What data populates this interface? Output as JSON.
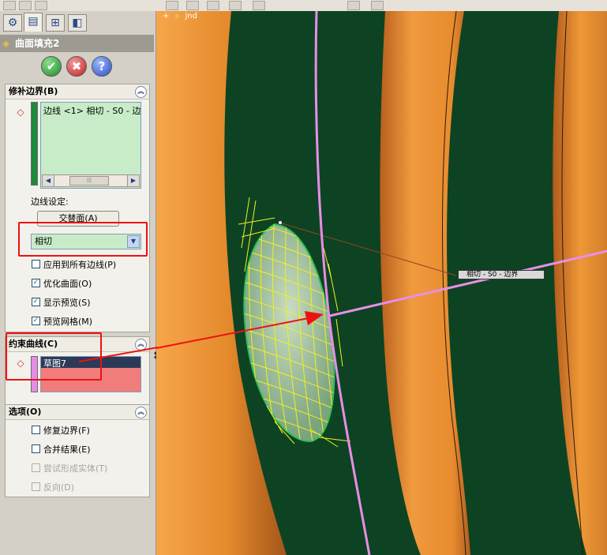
{
  "panel": {
    "feature_title": "曲面填充2",
    "tabs": [
      "feature-manager-icon",
      "property-manager-icon",
      "configuration-manager-icon",
      "display-manager-icon"
    ],
    "buttons": {
      "ok": "✔",
      "cancel": "✖",
      "help": "?"
    }
  },
  "patch_boundary": {
    "header": "修补边界(B)",
    "edge_item": "边线 <1> 相切 - S0 - 边",
    "edge_settings_label": "边线设定:",
    "alternate_face_button": "交替面(A)",
    "curvature_option": "相切",
    "checkboxes": [
      {
        "label": "应用到所有边线(P)",
        "checked": false
      },
      {
        "label": "优化曲面(O)",
        "checked": true
      },
      {
        "label": "显示预览(S)",
        "checked": true
      },
      {
        "label": "预览网格(M)",
        "checked": true
      }
    ]
  },
  "constraint_curves": {
    "header": "约束曲线(C)",
    "item": "草图7"
  },
  "options": {
    "header": "选项(O)",
    "checkboxes": [
      {
        "label": "修复边界(F)",
        "checked": false,
        "enabled": true
      },
      {
        "label": "合并结果(E)",
        "checked": false,
        "enabled": true
      },
      {
        "label": "尝试形成实体(T)",
        "checked": false,
        "enabled": false
      },
      {
        "label": "反向(D)",
        "checked": false,
        "enabled": false
      }
    ]
  },
  "viewport": {
    "tree_label": "jnd",
    "callout": "相切 - S0 - 边界"
  },
  "colors": {
    "orange": "#e48a2c",
    "dark_green": "#0d4322",
    "pink_curve": "#e88ee8",
    "preview_mesh": "#f0f020",
    "highlight": "#ee1111"
  }
}
